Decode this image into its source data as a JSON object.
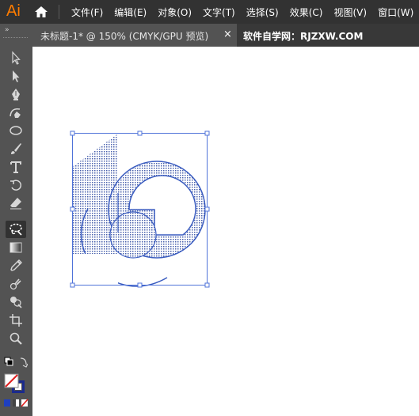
{
  "app": {
    "logo": "Ai"
  },
  "menu": [
    "文件(F)",
    "编辑(E)",
    "对象(O)",
    "文字(T)",
    "选择(S)",
    "效果(C)",
    "视图(V)",
    "窗口(W)"
  ],
  "tab": {
    "title": "未标题-1* @ 150% (CMYK/GPU 预览)",
    "close": "×",
    "watermark": "软件自学网：RJZXW.COM"
  },
  "toolbar": {
    "collapse": "»"
  },
  "colors": {
    "menubar": "#323232",
    "workspace": "#535353",
    "accent": "#ff7c00",
    "artwork_stroke": "#3a5cc0",
    "selection": "#4f73d9"
  },
  "tools": [
    "selection-tool",
    "direct-selection-tool",
    "pen-tool",
    "curvature-tool",
    "ellipse-tool",
    "paintbrush-tool",
    "type-tool",
    "rotate-tool",
    "eraser-tool",
    "lasso-tool",
    "gradient-tool",
    "eyedropper-tool",
    "blend-tool",
    "shape-builder-tool",
    "artboard-tool",
    "zoom-tool"
  ]
}
